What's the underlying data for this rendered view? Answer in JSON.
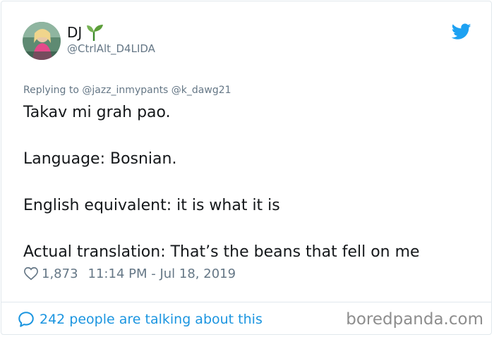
{
  "tweet": {
    "display_name": "DJ",
    "handle": "@CtrlAlt_D4LIDA",
    "replying_to": "Replying to @jazz_inmypants @k_dawg21",
    "lines": [
      "Takav mi grah pao.",
      "Language: Bosnian.",
      "English equivalent: it is what it is",
      "Actual translation: That’s the beans that fell on me"
    ],
    "likes": "1,873",
    "timestamp": "11:14 PM - Jul 18, 2019",
    "talking": "242 people are talking about this"
  },
  "watermark": "boredpanda.com",
  "icons": {
    "brand": "twitter-bird-icon",
    "like": "heart-icon",
    "reply": "speech-bubble-icon",
    "name_emoji": "seedling-icon"
  },
  "colors": {
    "twitter_blue": "#1da1f2",
    "link_blue": "#1b95e0",
    "secondary_text": "#657786",
    "primary_text": "#14171a"
  }
}
